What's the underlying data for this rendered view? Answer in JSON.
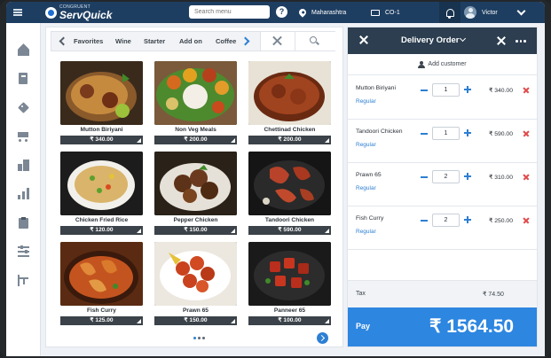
{
  "app": {
    "logo_small": "CONGRUENT",
    "logo_big": "ServQuick"
  },
  "topbar": {
    "search_placeholder": "Search menu",
    "help_label": "?",
    "location": "Maharashtra",
    "counter": "CO-1",
    "user_name": "Victor"
  },
  "sidebar": {
    "items": [
      "home-icon",
      "book-icon",
      "tag-icon",
      "cart-icon",
      "buildings-icon",
      "chart-icon",
      "clipboard-icon",
      "sliders-icon",
      "timeline-icon"
    ]
  },
  "categories": [
    "Favorites",
    "Wine",
    "Starter",
    "Add on",
    "Coffee"
  ],
  "menu_items": [
    {
      "name": "Mutton Biriyani",
      "price": "₹ 340.00",
      "color": "#c68a3f"
    },
    {
      "name": "Non Veg Meals",
      "price": "₹ 200.00",
      "color": "#5c9a3a"
    },
    {
      "name": "Chettinad Chicken",
      "price": "₹ 200.00",
      "color": "#a0441f"
    },
    {
      "name": "Chicken Fried Rice",
      "price": "₹ 120.00",
      "color": "#d9b46a"
    },
    {
      "name": "Pepper Chicken",
      "price": "₹ 150.00",
      "color": "#6b3a1e"
    },
    {
      "name": "Tandoori Chicken",
      "price": "₹ 590.00",
      "color": "#b8432a"
    },
    {
      "name": "Fish Curry",
      "price": "₹ 125.00",
      "color": "#c4541f"
    },
    {
      "name": "Prawn 65",
      "price": "₹ 150.00",
      "color": "#c9431e"
    },
    {
      "name": "Panneer 65",
      "price": "₹ 100.00",
      "color": "#b92e1c"
    }
  ],
  "pagination": {
    "pages": 3,
    "current": 1
  },
  "order": {
    "title": "Delivery Order",
    "add_customer": "Add customer",
    "lines": [
      {
        "name": "Mutton Biriyani",
        "variant": "Regular",
        "qty": "1",
        "price": "₹ 340.00"
      },
      {
        "name": "Tandoori Chicken",
        "variant": "Regular",
        "qty": "1",
        "price": "₹ 590.00"
      },
      {
        "name": "Prawn 65",
        "variant": "Regular",
        "qty": "2",
        "price": "₹ 310.00"
      },
      {
        "name": "Fish Curry",
        "variant": "Regular",
        "qty": "2",
        "price": "₹ 250.00"
      }
    ],
    "tax_label": "Tax",
    "tax_value": "₹ 74.50",
    "pay_label": "Pay",
    "pay_total": "₹ 1564.50"
  },
  "colors": {
    "topbar": "#1e3e61",
    "accent": "#2d86e0",
    "delete": "#e04b4b",
    "order_header": "#2c3e50"
  }
}
